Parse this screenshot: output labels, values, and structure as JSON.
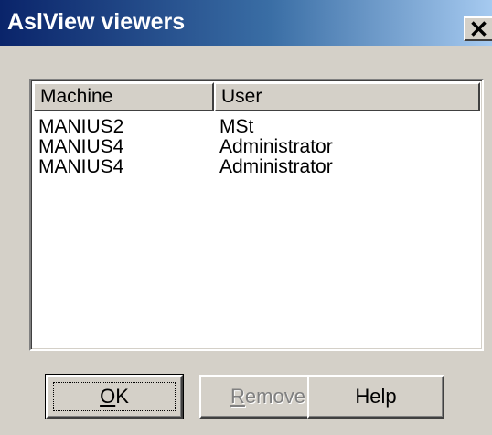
{
  "window": {
    "title": "AslView viewers",
    "close_glyph": "×"
  },
  "list": {
    "columns": [
      "Machine",
      "User"
    ],
    "rows": [
      {
        "machine": "MANIUS2",
        "user": "MSt"
      },
      {
        "machine": "MANIUS4",
        "user": "Administrator"
      },
      {
        "machine": "MANIUS4",
        "user": "Administrator"
      }
    ]
  },
  "buttons": {
    "ok": {
      "label": "OK",
      "accelerator": "O"
    },
    "remove": {
      "label": "Remove",
      "accelerator": "R",
      "enabled": false
    },
    "help": {
      "label": "Help"
    }
  }
}
